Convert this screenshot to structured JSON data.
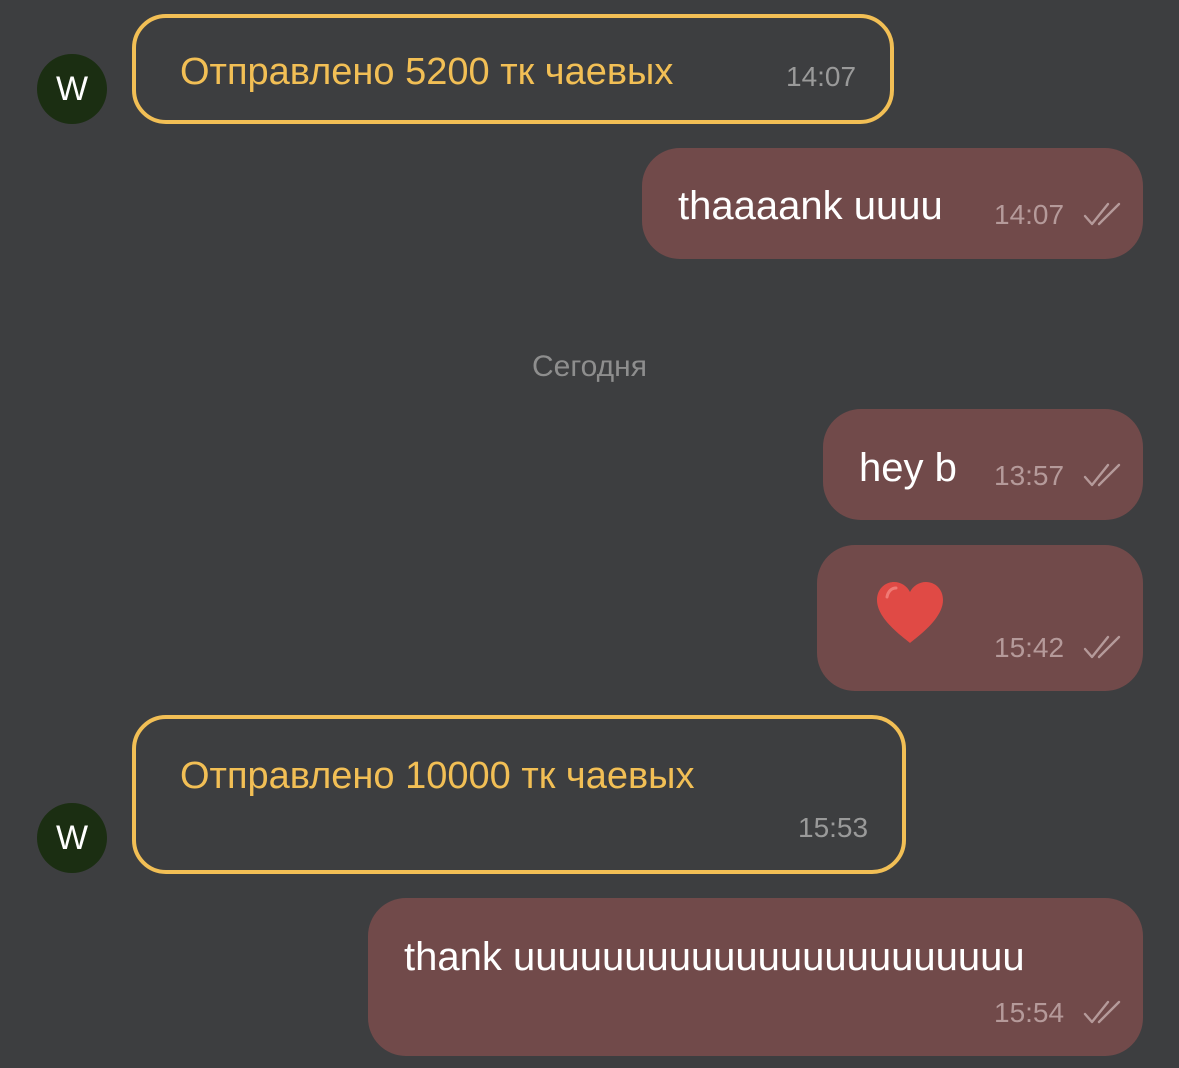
{
  "messages": [
    {
      "avatar_letter": "W",
      "text": "Отправлено 5200 тк чаевых",
      "time": "14:07"
    },
    {
      "text": "thaaaank uuuu",
      "time": "14:07"
    },
    {
      "text": "hey b",
      "time": "13:57"
    },
    {
      "emoji": "heart",
      "time": "15:42"
    },
    {
      "avatar_letter": "W",
      "text": "Отправлено 10000 тк чаевых",
      "time": "15:53"
    },
    {
      "text": "thank uuuuuuuuuuuuuuuuuuuuuuu",
      "time": "15:54"
    }
  ],
  "date_separator": "Сегодня",
  "colors": {
    "background": "#3d3e40",
    "tip_accent": "#f2bf55",
    "outgoing_bubble": "#714a4a",
    "avatar": "#1b2e12",
    "heart": "#e04a45"
  }
}
